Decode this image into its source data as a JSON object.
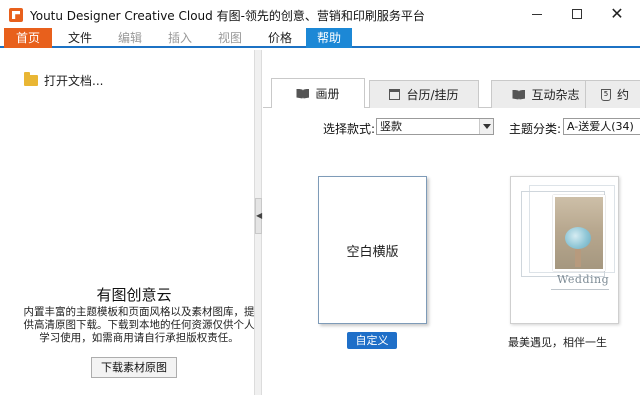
{
  "window": {
    "title": "Youtu Designer Creative Cloud 有图-领先的创意、营销和印刷服务平台"
  },
  "menu": {
    "home": "首页",
    "file": "文件",
    "edit": "编辑",
    "insert": "插入",
    "view": "视图",
    "price": "价格",
    "help": "帮助"
  },
  "left": {
    "open_doc": "打开文档...",
    "promo_title": "有图创意云",
    "promo_desc": "内置丰富的主题模板和页面风格以及素材图库，提供高清原图下载。下载到本地的任何资源仅供个人学习使用，如需商用请自行承担版权责任。",
    "download_button": "下载素材原图"
  },
  "tabs": [
    {
      "label": "画册",
      "icon": "book-icon"
    },
    {
      "label": "台历/挂历",
      "icon": "calendar-icon"
    },
    {
      "label": "互动杂志",
      "icon": "book-icon"
    },
    {
      "label": "约",
      "icon": "html5-icon"
    }
  ],
  "filters": {
    "style_label": "选择款式:",
    "style_value": "竖款",
    "theme_label": "主题分类:",
    "theme_value": "A-送爱人(34)"
  },
  "templates": {
    "blank_label": "空白横版",
    "custom_button": "自定义",
    "wedding_text": "Wedding",
    "wedding_caption": "最美遇见，相伴一生"
  }
}
